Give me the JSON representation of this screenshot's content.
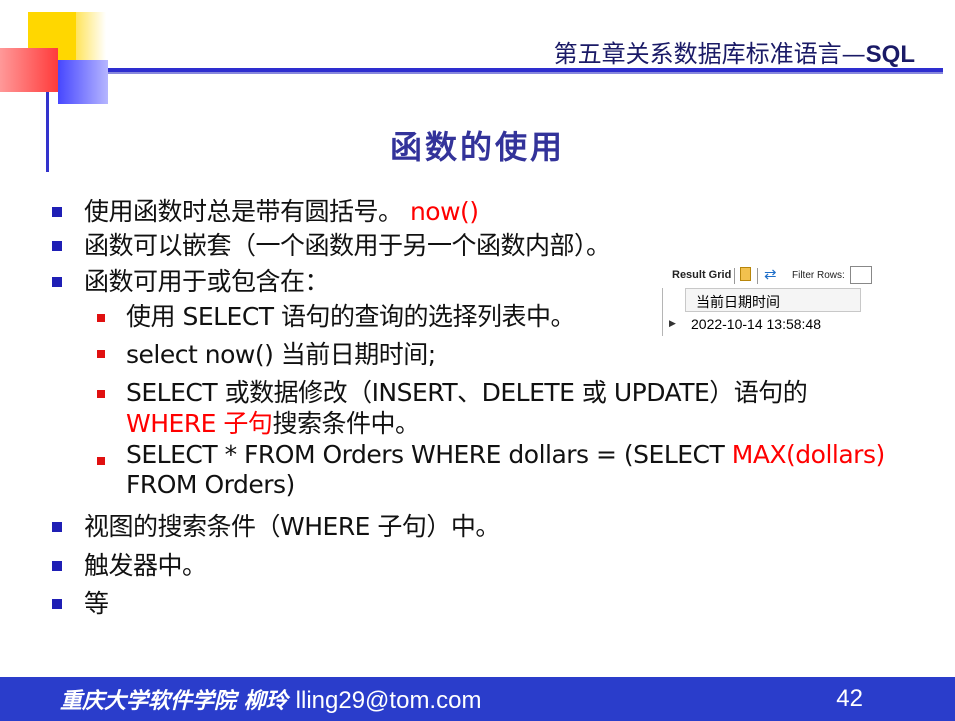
{
  "header": {
    "chapter_prefix": "第五章关系数据库标准语言—",
    "chapter_sql": "SQL"
  },
  "title": "函数的使用",
  "bullets": [
    {
      "text": "使用函数时总是带有圆括号。",
      "highlight": " now()"
    },
    {
      "text": "函数可以嵌套（一个函数用于另一个函数内部）。"
    },
    {
      "text": "函数可用于或包含在："
    },
    {
      "text": "使用 SELECT 语句的查询的选择列表中。"
    },
    {
      "text": "select now() 当前日期时间;"
    },
    {
      "text": "SELECT 或数据修改（INSERT、DELETE 或 UPDATE）语句的"
    },
    {
      "highlight": "WHERE 子句",
      "text": "搜索条件中。"
    },
    {
      "text": " SELECT * FROM Orders WHERE dollars = (SELECT ",
      "highlight": "MAX(dollars)"
    },
    {
      "text": "FROM Orders)"
    },
    {
      "text": "视图的搜索条件（WHERE 子句）中。"
    },
    {
      "text": "触发器中。"
    },
    {
      "text": "等"
    }
  ],
  "result_grid": {
    "toolbar_label": "Result Grid",
    "filter_label": "Filter Rows:",
    "column_header": "当前日期时间",
    "row_value": "2022-10-14 13:58:48"
  },
  "footer": {
    "school": "重庆大学软件学院 柳玲",
    "email": "lling29@tom.com",
    "page": "42"
  },
  "colors": {
    "accent_blue": "#2a3dcb",
    "highlight_red": "#ff0000",
    "title_color": "#33339a"
  }
}
